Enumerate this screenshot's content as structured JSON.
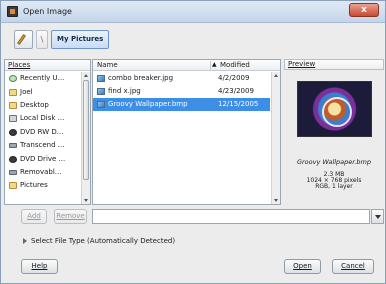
{
  "window": {
    "title": "Open Image",
    "close_label": "x"
  },
  "pathbar": {
    "separator": "\\",
    "current": "My Pictures"
  },
  "places": {
    "header": "Places",
    "items": [
      {
        "label": "Recently U...",
        "icon": "recent-icon"
      },
      {
        "label": "Joel",
        "icon": "folder-icon"
      },
      {
        "label": "Desktop",
        "icon": "desktop-icon"
      },
      {
        "label": "Local Disk ...",
        "icon": "disk-icon"
      },
      {
        "label": "DVD RW D...",
        "icon": "dvd-icon"
      },
      {
        "label": "Transcend ...",
        "icon": "usb-icon"
      },
      {
        "label": "DVD Drive ...",
        "icon": "dvd-icon"
      },
      {
        "label": "Removabl...",
        "icon": "usb-icon"
      },
      {
        "label": "Pictures",
        "icon": "folder-icon"
      }
    ]
  },
  "files": {
    "col_name": "Name",
    "sort_indicator": "▲",
    "col_modified": "Modified",
    "rows": [
      {
        "name": "combo breaker.jpg",
        "modified": "4/2/2009",
        "selected": false
      },
      {
        "name": "find x.jpg",
        "modified": "4/23/2009",
        "selected": false
      },
      {
        "name": "Groovy Wallpaper.bmp",
        "modified": "12/15/2005",
        "selected": true
      }
    ]
  },
  "preview": {
    "header": "Preview",
    "filename": "Groovy Wallpaper.bmp",
    "size": "2.3 MB",
    "dimensions": "1024 × 768 pixels",
    "layers": "RGB, 1 layer"
  },
  "actions": {
    "add": "Add",
    "remove": "Remove",
    "filter_value": ""
  },
  "expander": {
    "label": "Select File Type (Automatically Detected)"
  },
  "buttons": {
    "help": "Help",
    "open": "Open",
    "cancel": "Cancel"
  },
  "colors": {
    "selection": "#3d8ee6",
    "title_bg": "#c4d5ea",
    "close": "#c94a32"
  }
}
